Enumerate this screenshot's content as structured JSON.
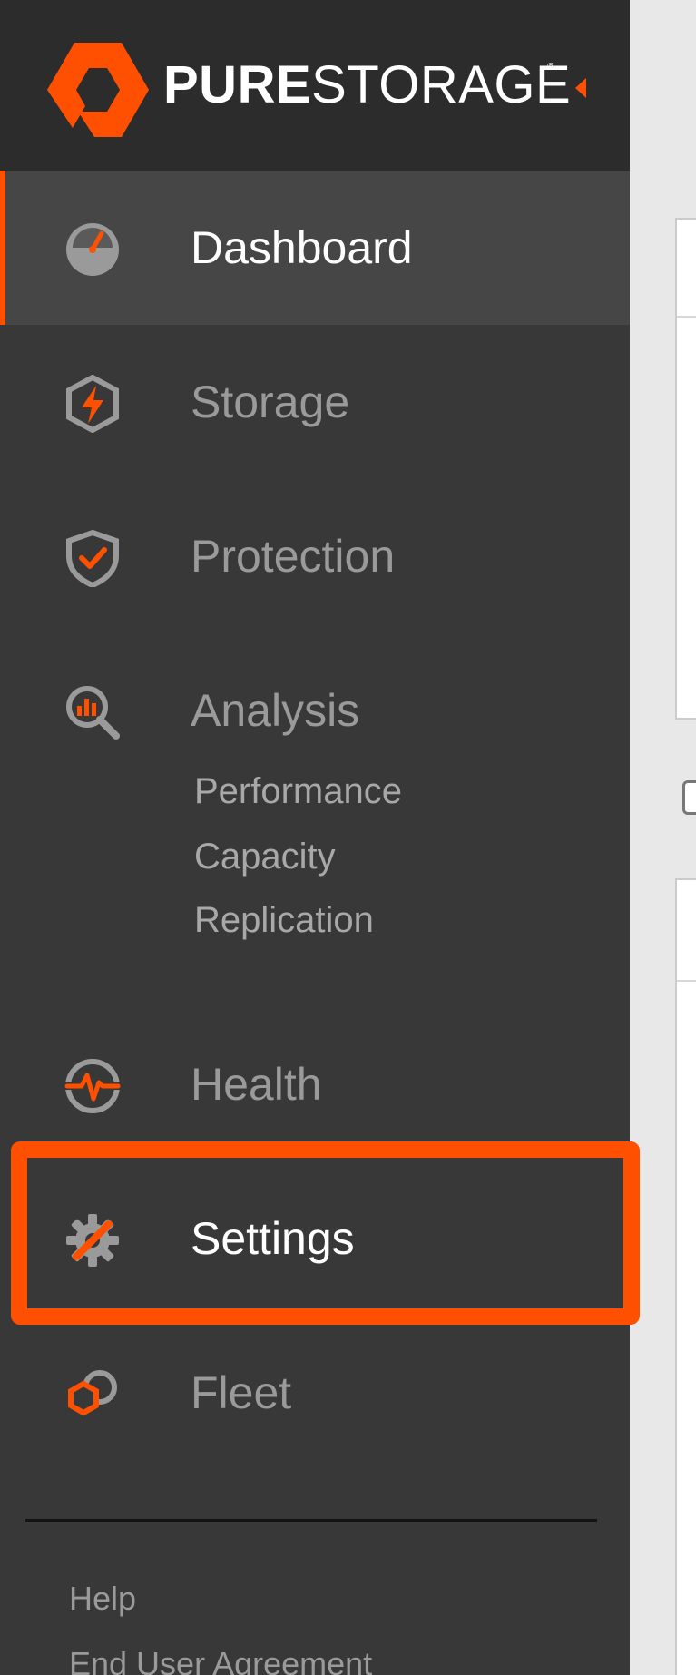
{
  "brand": {
    "name_bold": "PURE",
    "name_light": "STORAGE",
    "registered_mark": "®",
    "accent_color": "#fe5000"
  },
  "nav": {
    "dashboard": {
      "label": "Dashboard",
      "icon": "speedometer-icon",
      "active": true
    },
    "storage": {
      "label": "Storage",
      "icon": "hexagon-bolt-icon"
    },
    "protection": {
      "label": "Protection",
      "icon": "shield-check-icon"
    },
    "analysis": {
      "label": "Analysis",
      "icon": "magnifier-chart-icon",
      "subitems": [
        "Performance",
        "Capacity",
        "Replication"
      ]
    },
    "health": {
      "label": "Health",
      "icon": "heartbeat-icon"
    },
    "settings": {
      "label": "Settings",
      "icon": "gear-wrench-icon",
      "highlighted": true
    },
    "fleet": {
      "label": "Fleet",
      "icon": "fleet-hexagons-icon"
    }
  },
  "footer": {
    "help": "Help",
    "eula": "End User Agreement"
  }
}
